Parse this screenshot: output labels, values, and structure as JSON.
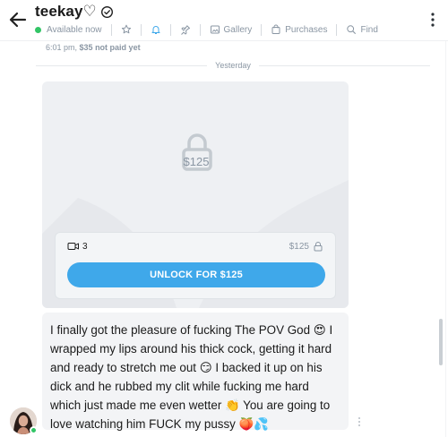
{
  "header": {
    "username": "teekay♡",
    "status": "Available now",
    "nav": {
      "gallery": "Gallery",
      "purchases": "Purchases",
      "find": "Find"
    }
  },
  "meta": {
    "time": "6:01 pm,",
    "payment": "$35 not paid yet"
  },
  "divider": {
    "label": "Yesterday"
  },
  "locked_media": {
    "overlay_price": "$125",
    "media_count": "3",
    "price": "$125",
    "unlock_label": "UNLOCK FOR $125"
  },
  "message": {
    "text": "I finally got the pleasure of fucking The POV God 😍 I wrapped my lips around his thick cock, getting it hard and ready to stretch me out 😏 I backed it up on his dick and he rubbed my clit while fucking me hard which just made me even wetter 👏 You are going to love watching him FUCK my pussy 🍑💦"
  },
  "colors": {
    "accent": "#3fa8ea",
    "online": "#32c566",
    "muted": "#8a96a3"
  }
}
